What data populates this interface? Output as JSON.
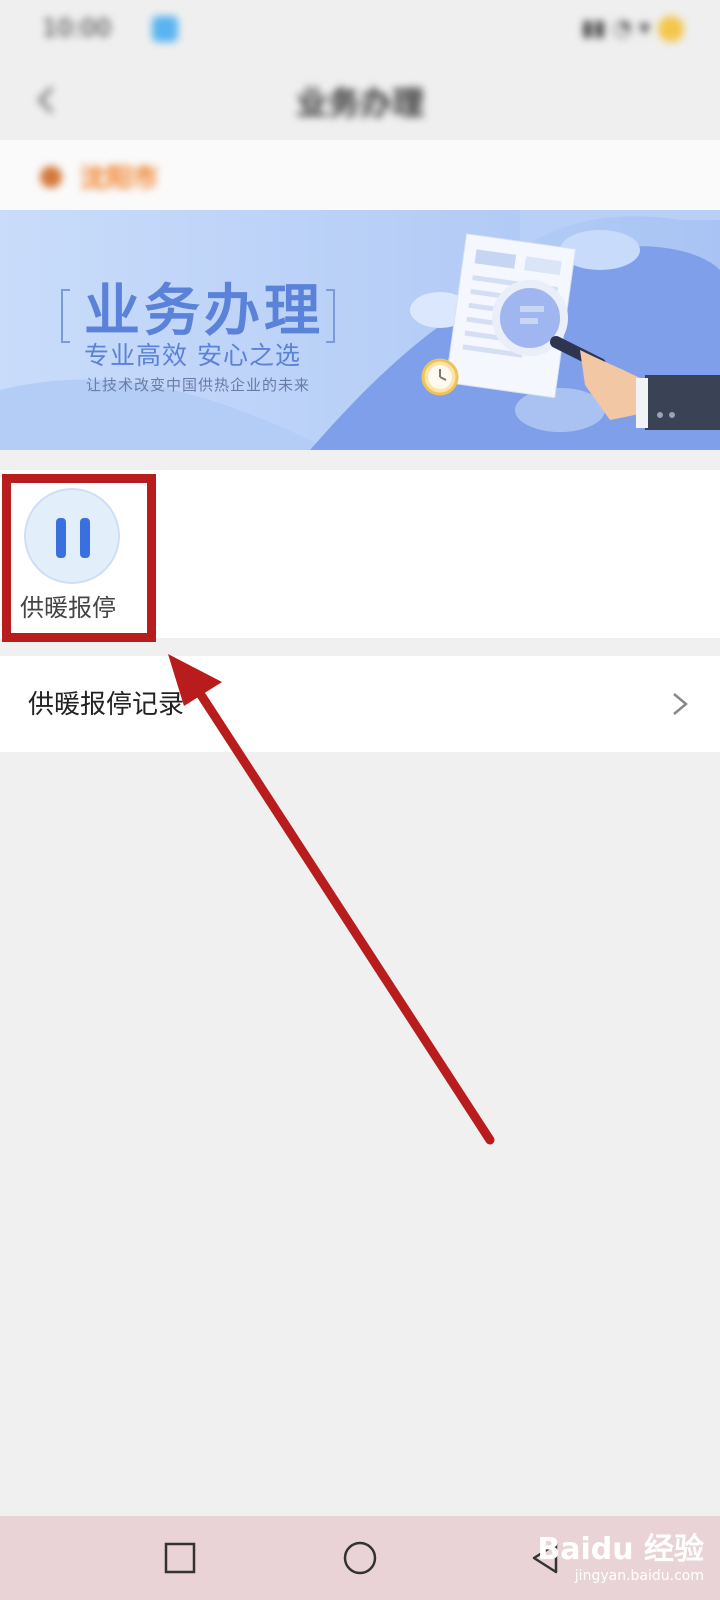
{
  "status_bar": {
    "time": "10:00"
  },
  "title_bar": {
    "title": "业务办理"
  },
  "location": {
    "name": "沈阳市"
  },
  "banner": {
    "title": "业务办理",
    "subtitle": "专业高效   安心之选",
    "tagline": "让技术改变中国供热企业的未来"
  },
  "functions": [
    {
      "label": "供暖报停",
      "icon": "pause-icon"
    }
  ],
  "records": {
    "label": "供暖报停记录"
  },
  "watermark": {
    "logo": "Baidu 经验",
    "url": "jingyan.baidu.com"
  },
  "colors": {
    "highlight": "#b81c1c",
    "accent": "#3a6fe0",
    "banner_text": "#5b82d9"
  }
}
